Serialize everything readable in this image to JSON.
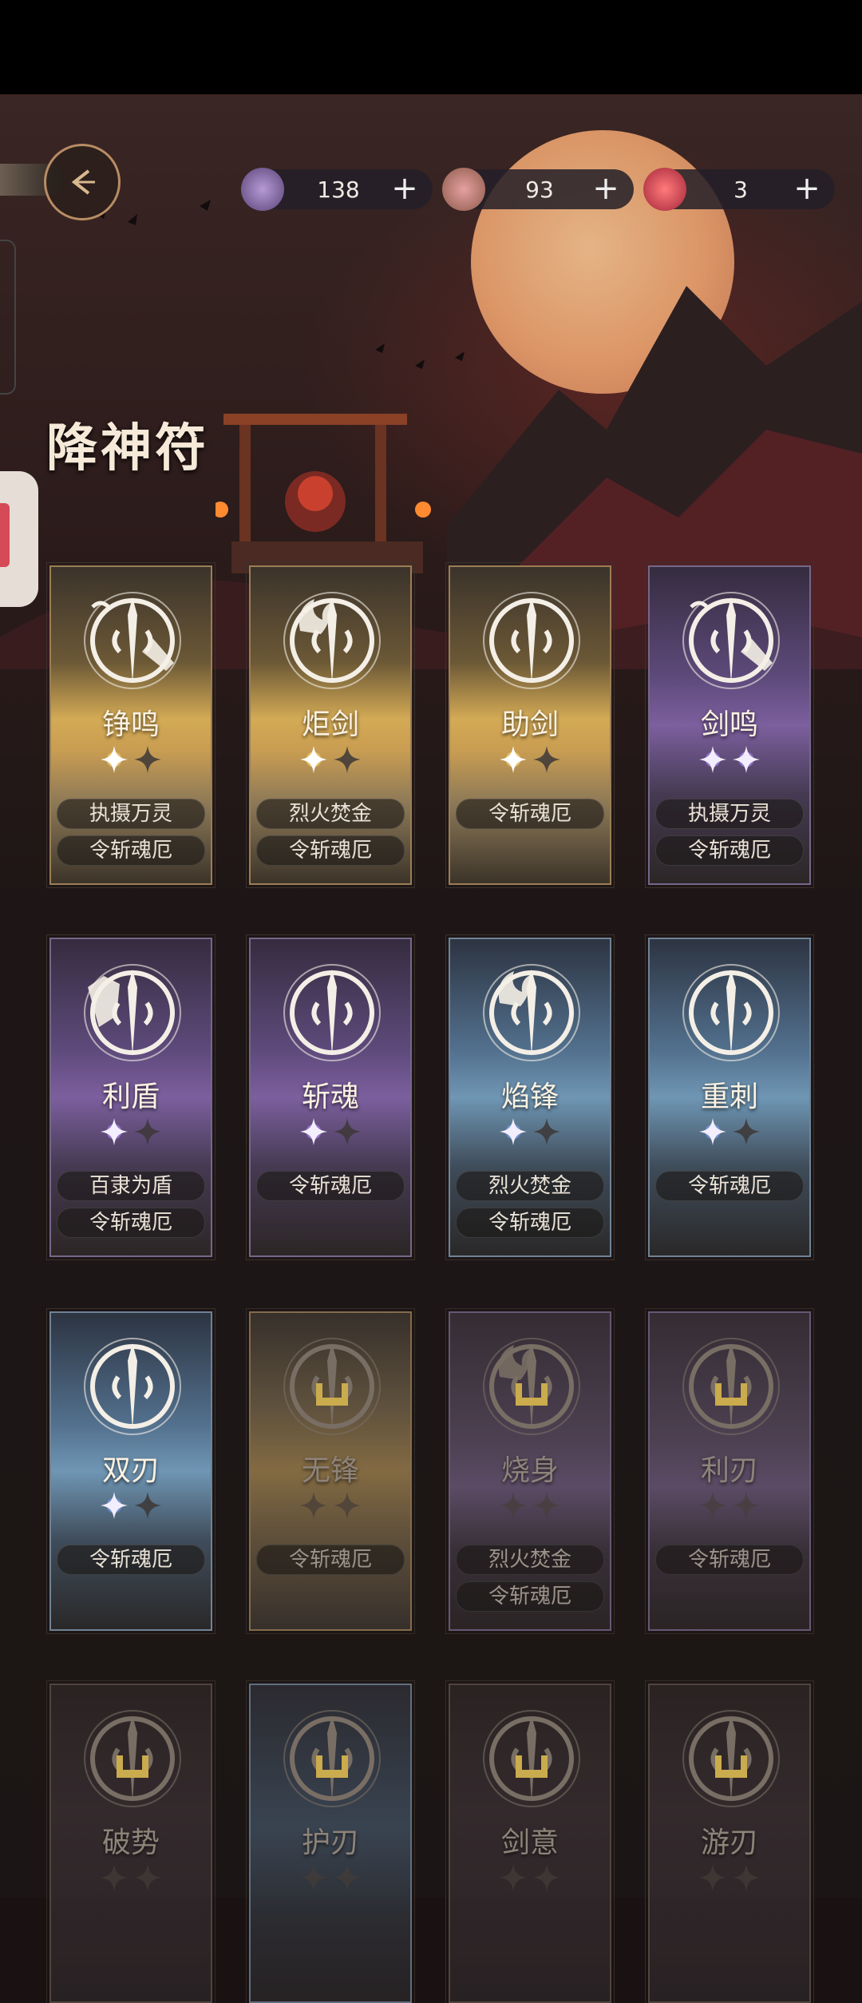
{
  "page_title": "降神符",
  "currencies": [
    {
      "icon": "soul-crystal-icon",
      "value": "138"
    },
    {
      "icon": "incense-bowl-icon",
      "value": "93"
    },
    {
      "icon": "red-orb-icon",
      "value": "3"
    }
  ],
  "cards": [
    {
      "name": "铮鸣",
      "rarity": "gold",
      "stars_lit": 1,
      "stars_total": 2,
      "locked": false,
      "tags": [
        "执摄万灵",
        "令斩魂厄"
      ],
      "emblem": "twin-sword-emblem-icon"
    },
    {
      "name": "炬剑",
      "rarity": "gold",
      "stars_lit": 1,
      "stars_total": 2,
      "locked": false,
      "tags": [
        "烈火焚金",
        "令斩魂厄"
      ],
      "emblem": "flame-sword-emblem-icon"
    },
    {
      "name": "助剑",
      "rarity": "gold",
      "stars_lit": 1,
      "stars_total": 2,
      "locked": false,
      "tags": [
        "令斩魂厄"
      ],
      "emblem": "ring-sword-emblem-icon"
    },
    {
      "name": "剑鸣",
      "rarity": "purple",
      "stars_lit": 2,
      "stars_total": 2,
      "locked": false,
      "tags": [
        "执摄万灵",
        "令斩魂厄"
      ],
      "emblem": "twin-sword-emblem-icon"
    },
    {
      "name": "利盾",
      "rarity": "purple",
      "stars_lit": 1,
      "stars_total": 2,
      "locked": false,
      "tags": [
        "百隶为盾",
        "令斩魂厄"
      ],
      "emblem": "shield-sword-emblem-icon"
    },
    {
      "name": "斩魂",
      "rarity": "purple",
      "stars_lit": 1,
      "stars_total": 2,
      "locked": false,
      "tags": [
        "令斩魂厄"
      ],
      "emblem": "ring-sword-emblem-icon"
    },
    {
      "name": "焰锋",
      "rarity": "blue",
      "stars_lit": 1,
      "stars_total": 2,
      "locked": false,
      "tags": [
        "烈火焚金",
        "令斩魂厄"
      ],
      "emblem": "flame-sword-emblem-icon"
    },
    {
      "name": "重刺",
      "rarity": "blue",
      "stars_lit": 1,
      "stars_total": 2,
      "locked": false,
      "tags": [
        "令斩魂厄"
      ],
      "emblem": "ring-sword-emblem-icon"
    },
    {
      "name": "双刃",
      "rarity": "blue",
      "stars_lit": 1,
      "stars_total": 2,
      "locked": false,
      "tags": [
        "令斩魂厄"
      ],
      "emblem": "ring-sword-emblem-icon"
    },
    {
      "name": "无锋",
      "rarity": "gold",
      "stars_lit": 0,
      "stars_total": 2,
      "locked": true,
      "tags": [
        "令斩魂厄"
      ],
      "emblem": "ring-sword-emblem-icon"
    },
    {
      "name": "烧身",
      "rarity": "purple",
      "stars_lit": 0,
      "stars_total": 2,
      "locked": true,
      "tags": [
        "烈火焚金",
        "令斩魂厄"
      ],
      "emblem": "flame-sword-emblem-icon"
    },
    {
      "name": "利刃",
      "rarity": "purple",
      "stars_lit": 0,
      "stars_total": 2,
      "locked": true,
      "tags": [
        "令斩魂厄"
      ],
      "emblem": "ring-sword-emblem-icon"
    },
    {
      "name": "破势",
      "rarity": "dark",
      "stars_lit": 0,
      "stars_total": 2,
      "locked": true,
      "tags": [],
      "emblem": "ring-sword-emblem-icon"
    },
    {
      "name": "护刃",
      "rarity": "blue",
      "stars_lit": 0,
      "stars_total": 2,
      "locked": true,
      "tags": [],
      "emblem": "ring-sword-emblem-icon"
    },
    {
      "name": "剑意",
      "rarity": "dark",
      "stars_lit": 0,
      "stars_total": 2,
      "locked": true,
      "tags": [],
      "emblem": "ring-sword-emblem-icon"
    },
    {
      "name": "游刃",
      "rarity": "dark",
      "stars_lit": 0,
      "stars_total": 2,
      "locked": true,
      "tags": [],
      "emblem": "ring-sword-emblem-icon"
    }
  ]
}
